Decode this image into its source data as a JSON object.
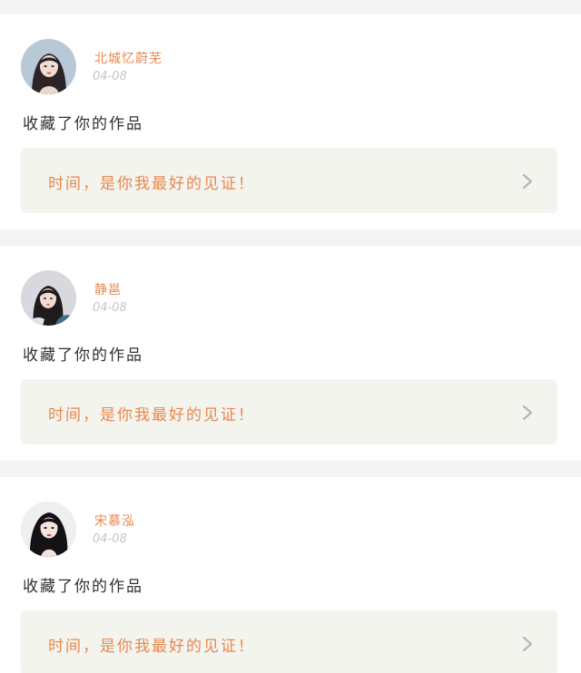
{
  "feed": {
    "items": [
      {
        "user_name": "北城忆蔚芜",
        "date": "04-08",
        "activity": "收藏了你的作品",
        "quote": "时间，是你我最好的见证！",
        "avatar_icon": "avatar-icon"
      },
      {
        "user_name": "静邕",
        "date": "04-08",
        "activity": "收藏了你的作品",
        "quote": "时间，是你我最好的见证！",
        "avatar_icon": "avatar-icon"
      },
      {
        "user_name": "宋慕泓",
        "date": "04-08",
        "activity": "收藏了你的作品",
        "quote": "时间，是你我最好的见证！",
        "avatar_icon": "avatar-icon"
      }
    ]
  },
  "colors": {
    "page_background": "#f4f4f4",
    "card_background": "#ffffff",
    "accent_orange": "#e8874f",
    "date_gray": "#c6c6c6",
    "quote_box_background": "#f4f4ef"
  },
  "icons": {
    "arrow": "chevron-right-icon"
  }
}
